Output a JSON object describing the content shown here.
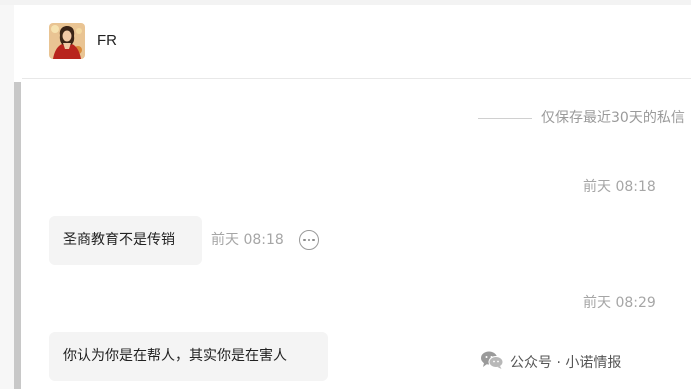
{
  "header": {
    "chat_name": "FR"
  },
  "notice": {
    "text": "仅保存最近30天的私信"
  },
  "messages": [
    {
      "type": "timestamp",
      "text": "前天 08:18"
    },
    {
      "type": "incoming",
      "text": "圣商教育不是传销",
      "time": "前天 08:18"
    },
    {
      "type": "timestamp",
      "text": "前天 08:29"
    },
    {
      "type": "incoming",
      "text": "你认为你是在帮人，其实你是在害人"
    }
  ],
  "watermark": {
    "text": "公众号 · 小诺情报",
    "icon": "wechat-icon"
  },
  "colors": {
    "bubble_bg": "#f4f4f4",
    "muted_text": "#a6a6a6",
    "scrollbar": "#c8c8c8"
  }
}
